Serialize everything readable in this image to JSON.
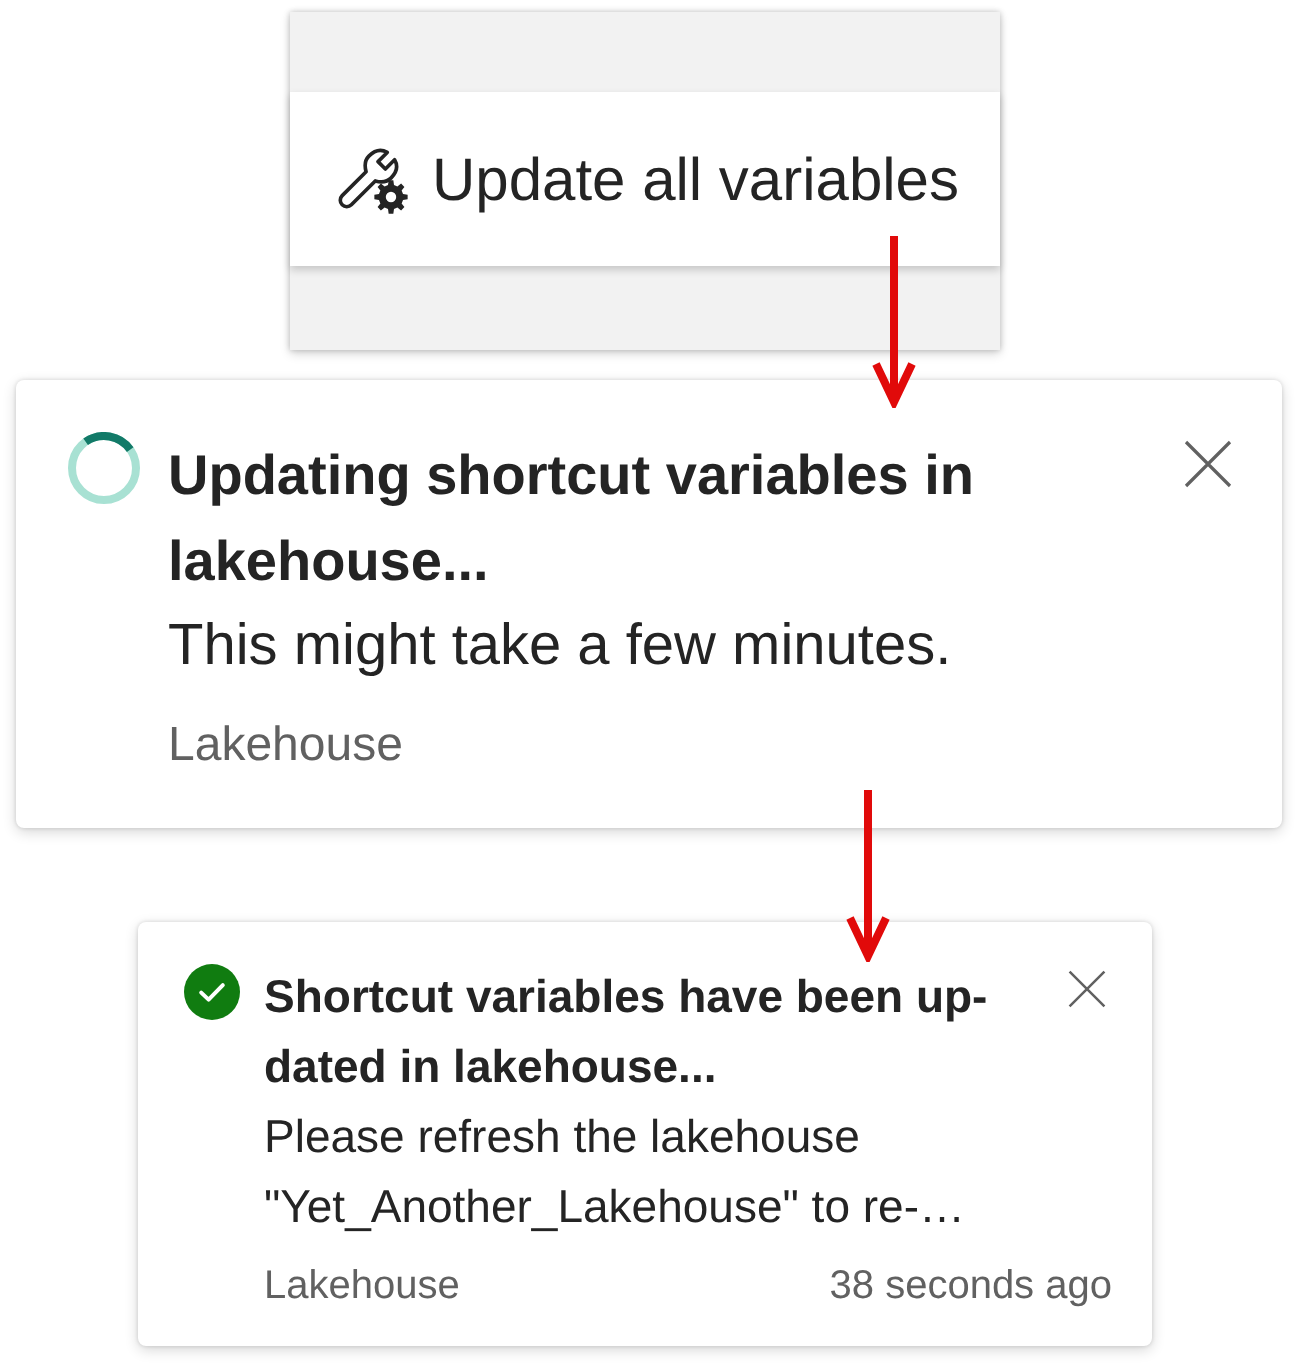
{
  "menu": {
    "items": [
      {
        "label": "Update all variables"
      }
    ]
  },
  "notifications": [
    {
      "kind": "progress",
      "title": "Updating shortcut variables in lakehouse...",
      "message": "This might take a few minutes.",
      "source": "Lakehouse"
    },
    {
      "kind": "success",
      "title": "Shortcut variables have been up-dated in lakehouse...",
      "message": "Please refresh the lakehouse \"Yet_Another_Lakehouse\" to re-…",
      "source": "Lakehouse",
      "time": "38 seconds ago"
    }
  ]
}
